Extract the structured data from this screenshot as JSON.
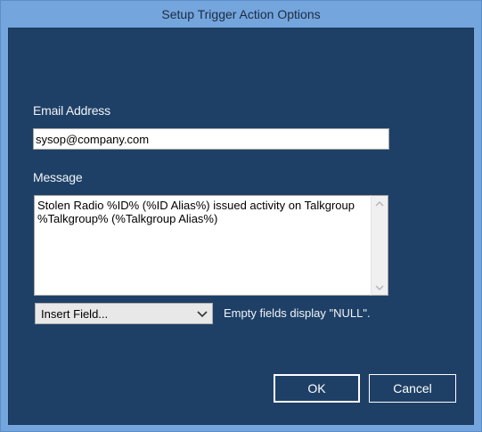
{
  "window": {
    "title": "Setup Trigger Action Options"
  },
  "form": {
    "email_label": "Email Address",
    "email_value": "sysop@company.com",
    "message_label": "Message",
    "message_value": "Stolen Radio %ID% (%ID Alias%) issued activity on Talkgroup %Talkgroup% (%Talkgroup Alias%)",
    "insert_field_value": "Insert Field...",
    "hint": "Empty fields display \"NULL\"."
  },
  "buttons": {
    "ok_label": "OK",
    "cancel_label": "Cancel"
  },
  "icons": {
    "scroll_up": "chevron-up-icon",
    "scroll_down": "chevron-down-icon",
    "dropdown": "chevron-down-icon"
  },
  "colors": {
    "frame": "#74a5dc",
    "client_bg": "#1f4066",
    "text_light": "#f0f4fa"
  }
}
